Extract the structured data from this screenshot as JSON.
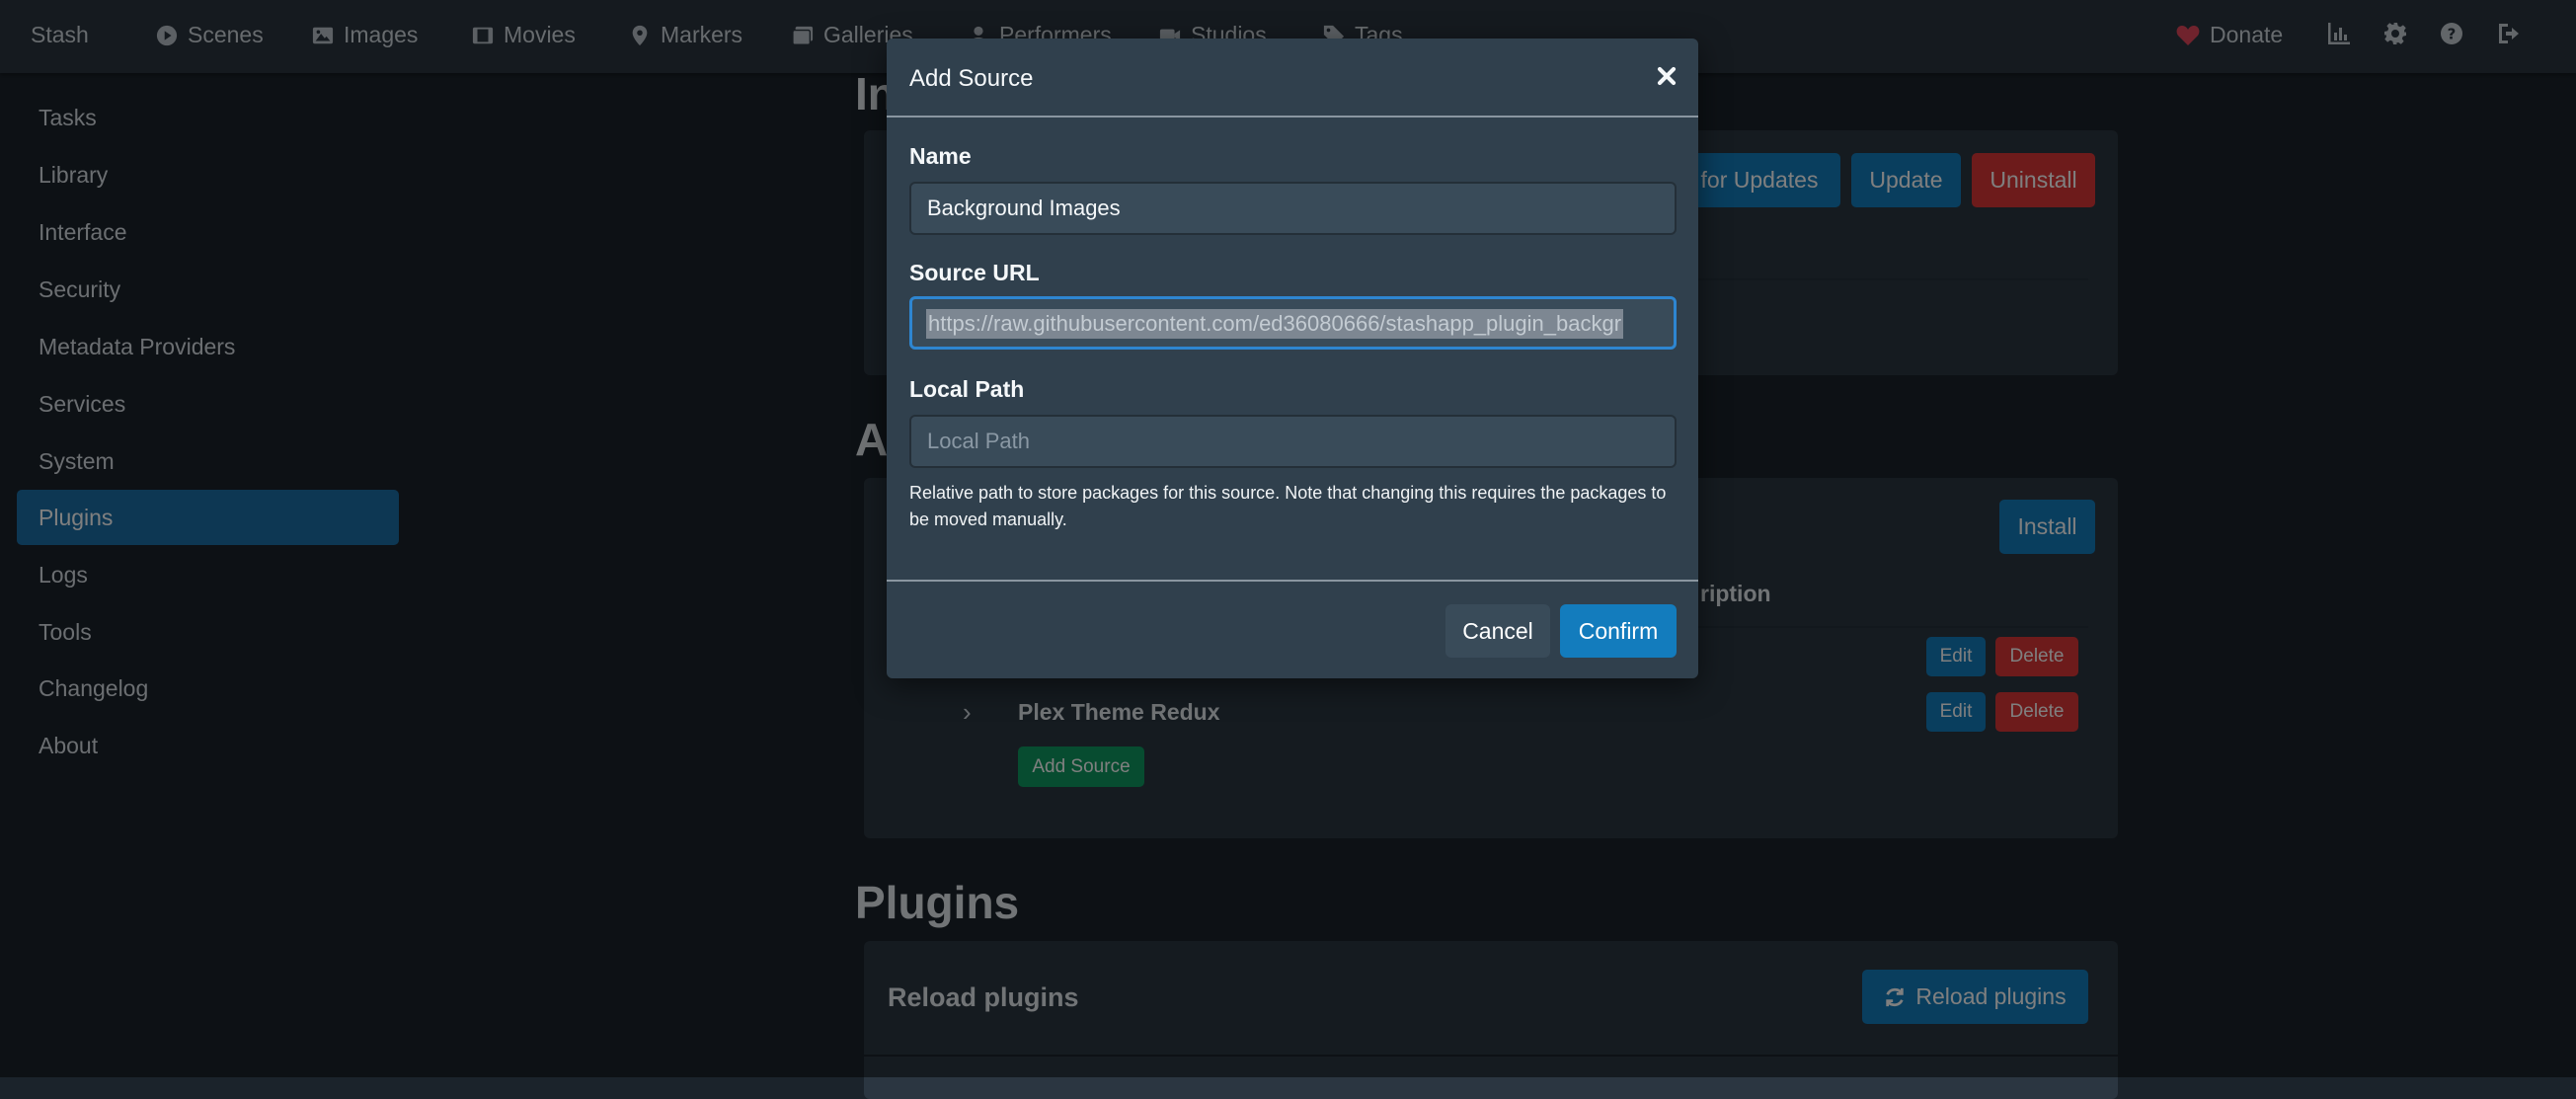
{
  "navbar": {
    "brand": "Stash",
    "items": [
      {
        "label": "Scenes",
        "icon": "play-circle-icon"
      },
      {
        "label": "Images",
        "icon": "image-icon"
      },
      {
        "label": "Movies",
        "icon": "film-icon"
      },
      {
        "label": "Markers",
        "icon": "map-marker-icon"
      },
      {
        "label": "Galleries",
        "icon": "images-icon"
      },
      {
        "label": "Performers",
        "icon": "user-icon"
      },
      {
        "label": "Studios",
        "icon": "video-icon"
      },
      {
        "label": "Tags",
        "icon": "tag-icon"
      }
    ],
    "donate": "Donate",
    "right_icons": [
      "chart-icon",
      "gear-icon",
      "help-icon",
      "logout-icon"
    ],
    "donate_color": "#e0475b"
  },
  "sidebar": {
    "items": [
      {
        "label": "Tasks"
      },
      {
        "label": "Library"
      },
      {
        "label": "Interface"
      },
      {
        "label": "Security"
      },
      {
        "label": "Metadata Providers"
      },
      {
        "label": "Services"
      },
      {
        "label": "System"
      },
      {
        "label": "Plugins",
        "active": true
      },
      {
        "label": "Logs"
      },
      {
        "label": "Tools"
      },
      {
        "label": "Changelog"
      },
      {
        "label": "About"
      }
    ]
  },
  "main": {
    "installed_title_partial": "In",
    "available_title_partial": "A",
    "check_updates_partial": "for Updates",
    "update_label": "Update",
    "uninstall_label": "Uninstall",
    "install_label": "Install",
    "description_header_partial": "ription",
    "edit_label": "Edit",
    "delete_label": "Delete",
    "source_name": "Plex Theme Redux",
    "add_source_label": "Add Source",
    "plugins_title": "Plugins",
    "reload_heading": "Reload plugins",
    "reload_button": "Reload plugins"
  },
  "modal": {
    "title": "Add Source",
    "name_label": "Name",
    "name_value": "Background Images",
    "url_label": "Source URL",
    "url_value": "https://raw.githubusercontent.com/ed36080666/stashapp_plugin_backgr",
    "path_label": "Local Path",
    "path_placeholder": "Local Path",
    "help_text": "Relative path to store packages for this source. Note that changing this requires the packages to be moved manually.",
    "cancel_label": "Cancel",
    "confirm_label": "Confirm"
  },
  "colors": {
    "accent": "#137cbd",
    "danger": "#db3737",
    "success": "#0f9960",
    "background": "#1b232b"
  }
}
